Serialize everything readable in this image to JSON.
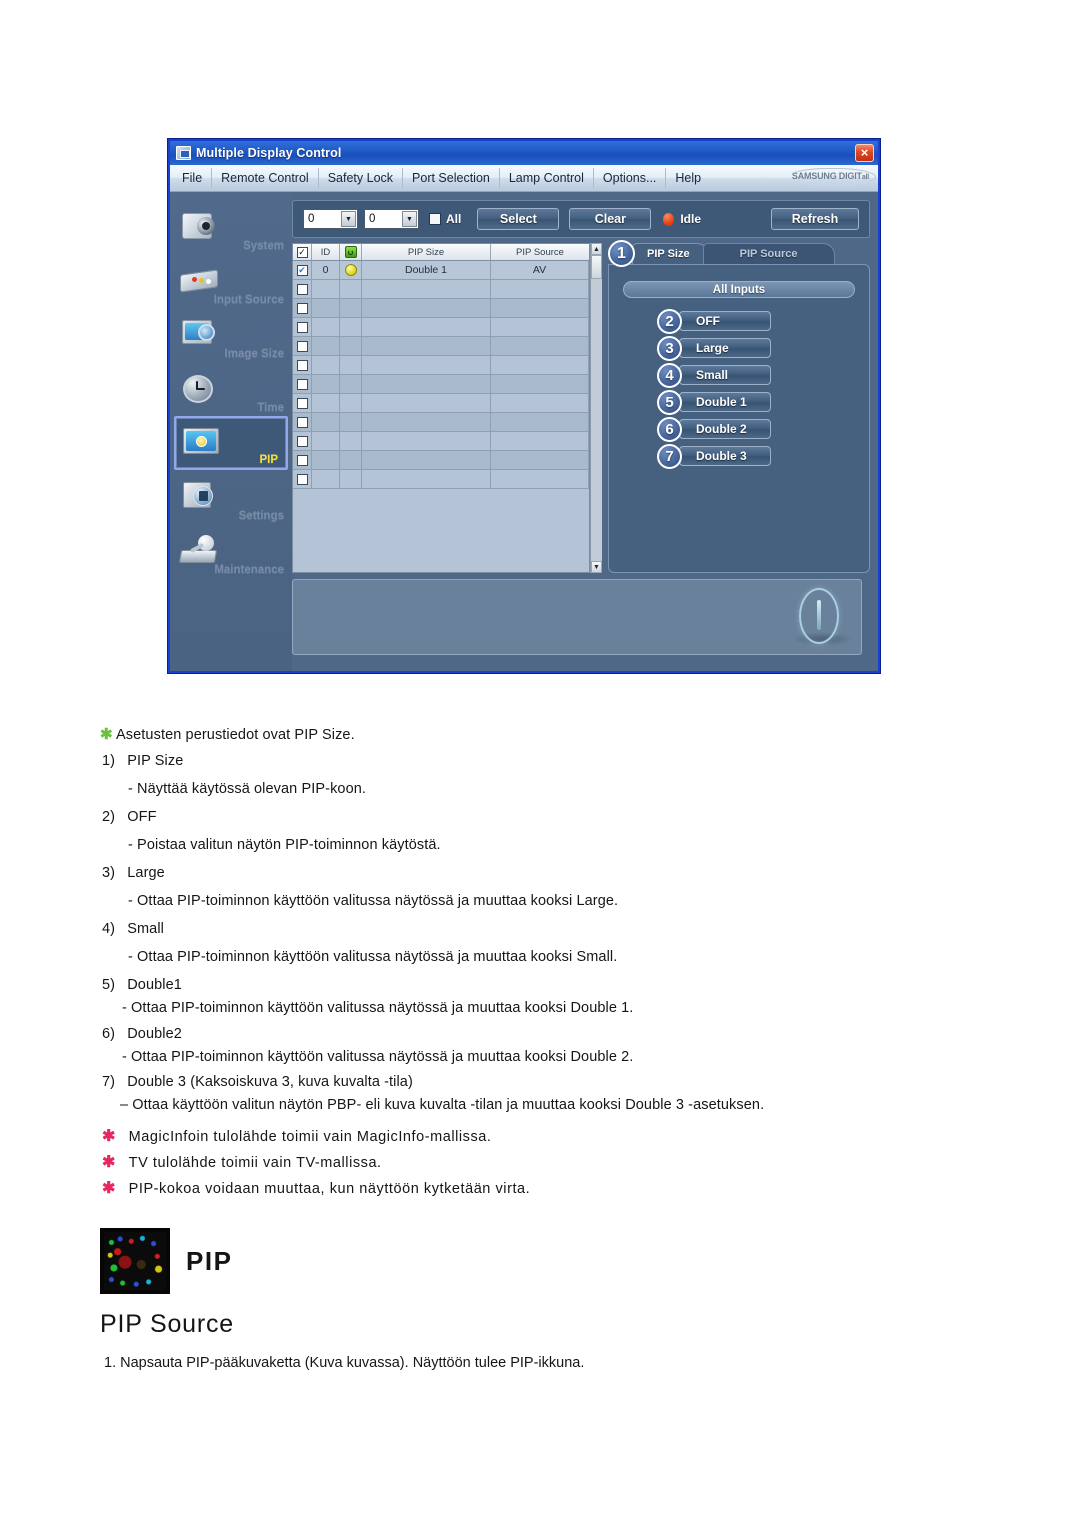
{
  "app": {
    "title": "Multiple Display Control",
    "close_label": "×",
    "brand": "SAMSUNG DIGIT",
    "brand_small": "all",
    "menu": [
      "File",
      "Remote Control",
      "Safety Lock",
      "Port Selection",
      "Lamp Control",
      "Options...",
      "Help"
    ],
    "toolbar": {
      "combo1_value": "0",
      "combo2_value": "0",
      "all_label": "All",
      "select_label": "Select",
      "clear_label": "Clear",
      "status_label": "Idle",
      "refresh_label": "Refresh"
    },
    "sidebar": [
      {
        "label": "System",
        "icon": "system-icon",
        "active": false
      },
      {
        "label": "Input Source",
        "icon": "input-source-icon",
        "active": false
      },
      {
        "label": "Image Size",
        "icon": "image-size-icon",
        "active": false
      },
      {
        "label": "Time",
        "icon": "clock-icon",
        "active": false
      },
      {
        "label": "PIP",
        "icon": "pip-icon",
        "active": true
      },
      {
        "label": "Settings",
        "icon": "settings-icon",
        "active": false
      },
      {
        "label": "Maintenance",
        "icon": "maintenance-icon",
        "active": false
      }
    ],
    "grid": {
      "headers": [
        "",
        "ID",
        "",
        "PIP Size",
        "PIP Source"
      ],
      "rows": [
        {
          "checked": true,
          "id": "0",
          "power": true,
          "pip_size": "Double 1",
          "pip_source": "AV"
        },
        {
          "checked": false,
          "id": "",
          "power": false,
          "pip_size": "",
          "pip_source": ""
        },
        {
          "checked": false,
          "id": "",
          "power": false,
          "pip_size": "",
          "pip_source": ""
        },
        {
          "checked": false,
          "id": "",
          "power": false,
          "pip_size": "",
          "pip_source": ""
        },
        {
          "checked": false,
          "id": "",
          "power": false,
          "pip_size": "",
          "pip_source": ""
        },
        {
          "checked": false,
          "id": "",
          "power": false,
          "pip_size": "",
          "pip_source": ""
        },
        {
          "checked": false,
          "id": "",
          "power": false,
          "pip_size": "",
          "pip_source": ""
        },
        {
          "checked": false,
          "id": "",
          "power": false,
          "pip_size": "",
          "pip_source": ""
        },
        {
          "checked": false,
          "id": "",
          "power": false,
          "pip_size": "",
          "pip_source": ""
        },
        {
          "checked": false,
          "id": "",
          "power": false,
          "pip_size": "",
          "pip_source": ""
        },
        {
          "checked": false,
          "id": "",
          "power": false,
          "pip_size": "",
          "pip_source": ""
        },
        {
          "checked": false,
          "id": "",
          "power": false,
          "pip_size": "",
          "pip_source": ""
        }
      ],
      "scroll_up": "▲",
      "scroll_down": "▼"
    },
    "tabs": [
      {
        "label": "PIP Size",
        "active": true,
        "badge": "1"
      },
      {
        "label": "PIP Source",
        "active": false,
        "badge": ""
      }
    ],
    "panel": {
      "all_inputs_label": "All Inputs",
      "options": [
        {
          "badge": "2",
          "label": "OFF"
        },
        {
          "badge": "3",
          "label": "Large"
        },
        {
          "badge": "4",
          "label": "Small"
        },
        {
          "badge": "5",
          "label": "Double 1"
        },
        {
          "badge": "6",
          "label": "Double 2"
        },
        {
          "badge": "7",
          "label": "Double 3"
        }
      ]
    }
  },
  "doc": {
    "note_intro": "Asetusten perustiedot ovat PIP Size.",
    "items": [
      {
        "num": "1)",
        "title": "PIP Size",
        "desc": "- Näyttää käytössä olevan PIP-koon."
      },
      {
        "num": "2)",
        "title": "OFF",
        "desc": "- Poistaa valitun näytön PIP-toiminnon käytöstä."
      },
      {
        "num": "3)",
        "title": "Large",
        "desc": "- Ottaa PIP-toiminnon käyttöön valitussa näytössä ja muuttaa kooksi Large."
      },
      {
        "num": "4)",
        "title": "Small",
        "desc": "- Ottaa PIP-toiminnon käyttöön valitussa näytössä ja muuttaa kooksi Small."
      },
      {
        "num": "5)",
        "title": "Double1",
        "desc": "- Ottaa PIP-toiminnon käyttöön valitussa näytössä ja muuttaa kooksi Double 1."
      },
      {
        "num": "6)",
        "title": "Double2",
        "desc": "- Ottaa PIP-toiminnon käyttöön valitussa näytössä ja muuttaa kooksi Double 2."
      },
      {
        "num": "7)",
        "title": "Double 3 (Kaksoiskuva 3, kuva kuvalta -tila)",
        "desc": "– Ottaa käyttöön valitun näytön PBP- eli kuva kuvalta -tilan ja muuttaa kooksi Double 3 -asetuksen."
      }
    ],
    "pink_notes": [
      "MagicInfoin tulolähde toimii vain MagicInfo-mallissa.",
      "TV tulolähde toimii vain TV-mallissa.",
      "PIP-kokoa voidaan muuttaa, kun näyttöön kytketään virta."
    ],
    "pip_heading": "PIP",
    "pip_source_heading": "PIP Source",
    "step1": "1.  Napsauta PIP-pääkuvaketta (Kuva kuvassa). Näyttöön tulee PIP-ikkuna."
  }
}
